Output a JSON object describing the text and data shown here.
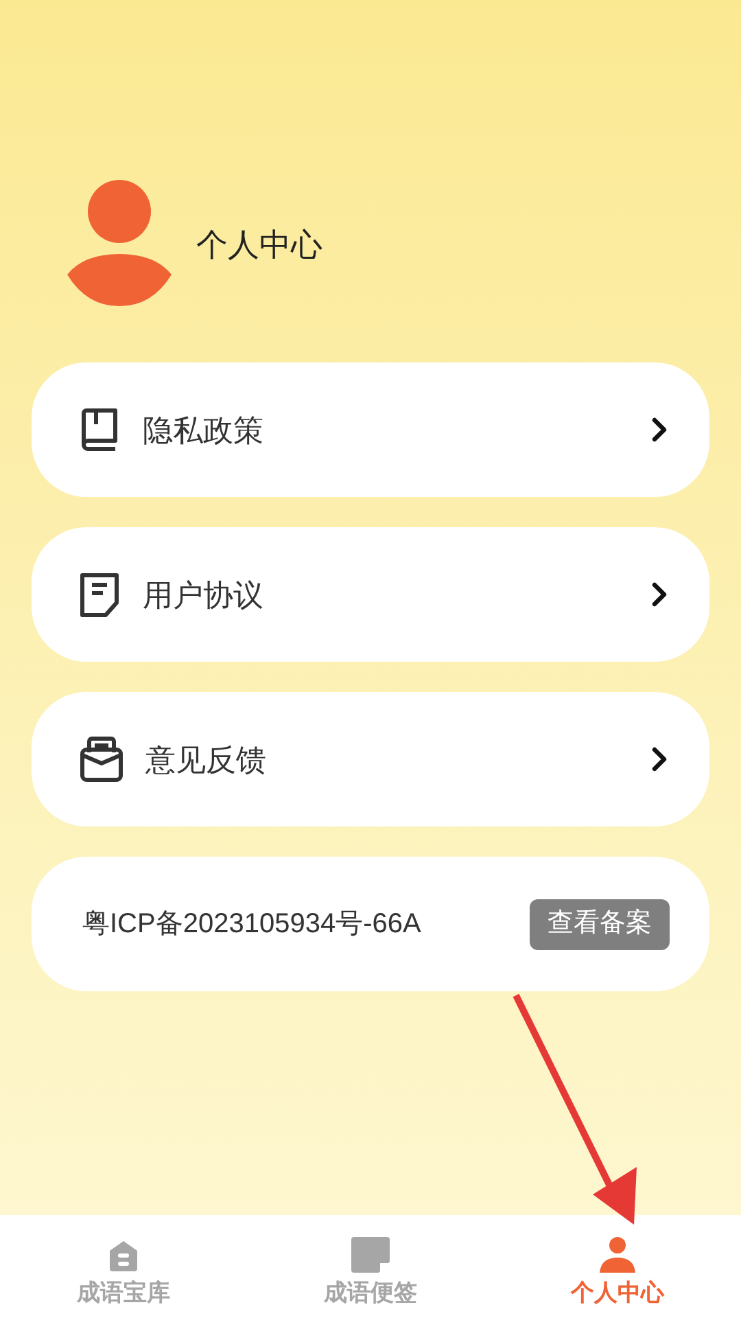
{
  "profile": {
    "title": "个人中心"
  },
  "menu": [
    {
      "label": "隐私政策",
      "kind": "book"
    },
    {
      "label": "用户协议",
      "kind": "note"
    },
    {
      "label": "意见反馈",
      "kind": "inbox"
    }
  ],
  "record": {
    "text": "粤ICP备2023105934号-66A",
    "button": "查看备案"
  },
  "tabs": [
    {
      "label": "成语宝库",
      "kind": "house",
      "selected": false
    },
    {
      "label": "成语便签",
      "kind": "sticky",
      "selected": false
    },
    {
      "label": "个人中心",
      "kind": "person",
      "selected": true
    }
  ]
}
